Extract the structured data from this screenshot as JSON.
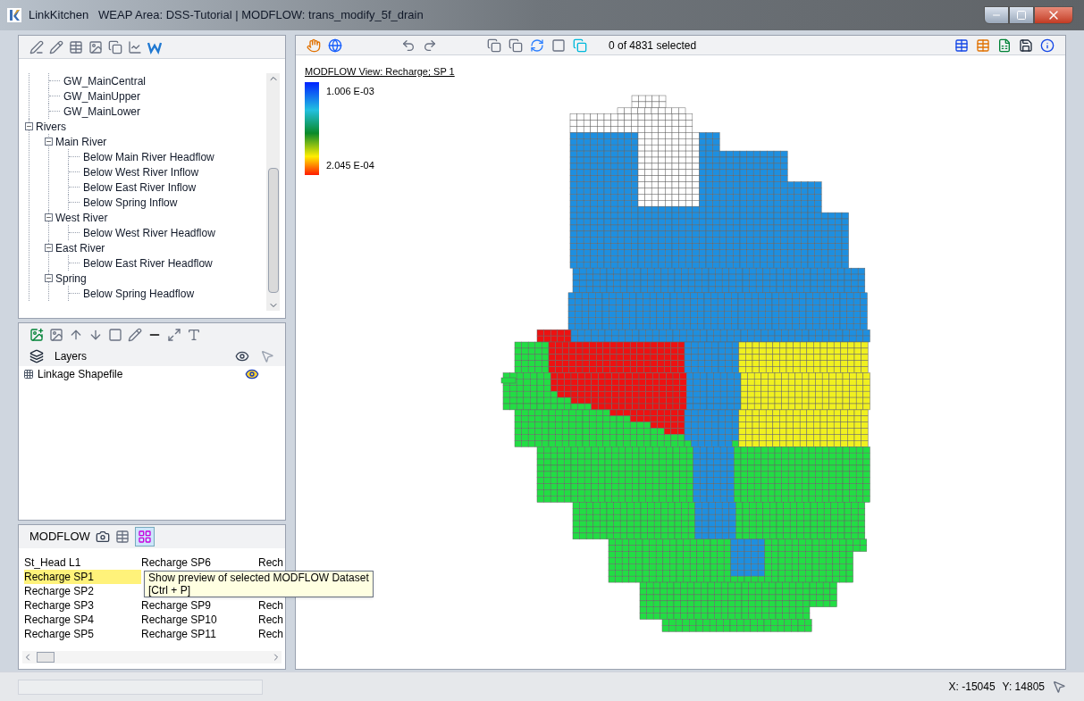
{
  "window": {
    "app_name": "LinkKitchen",
    "title": "WEAP Area: DSS-Tutorial | MODFLOW: trans_modify_5f_drain"
  },
  "tree": {
    "items": [
      {
        "children": [
          {
            "label": "GW_MainCentral"
          },
          {
            "label": "GW_MainUpper"
          },
          {
            "label": "GW_MainLower"
          }
        ]
      },
      {
        "label": "Rivers",
        "expanded": true,
        "children": [
          {
            "label": "Main River",
            "expanded": true,
            "children": [
              {
                "label": "Below Main River Headflow"
              },
              {
                "label": "Below West River Inflow"
              },
              {
                "label": "Below East River Inflow"
              },
              {
                "label": "Below Spring Inflow"
              }
            ]
          },
          {
            "label": "West River",
            "expanded": true,
            "children": [
              {
                "label": "Below West River Headflow"
              }
            ]
          },
          {
            "label": "East River",
            "expanded": true,
            "children": [
              {
                "label": "Below East River Headflow"
              }
            ]
          },
          {
            "label": "Spring",
            "expanded": true,
            "children": [
              {
                "label": "Below Spring Headflow"
              }
            ]
          }
        ]
      }
    ]
  },
  "layers": {
    "header": "Layers",
    "items": [
      {
        "label": "Linkage Shapefile",
        "visible": true
      }
    ]
  },
  "modflow": {
    "title": "MODFLOW",
    "columns": [
      [
        {
          "label": "St_Head L1",
          "selected": false
        },
        {
          "label": "Recharge SP1",
          "selected": true
        },
        {
          "label": "Recharge SP2",
          "selected": false
        },
        {
          "label": "Recharge SP3",
          "selected": false
        },
        {
          "label": "Recharge SP4",
          "selected": false
        },
        {
          "label": "Recharge SP5",
          "selected": false
        }
      ],
      [
        {
          "label": "Recharge SP6",
          "selected": false
        },
        null,
        null,
        {
          "label": "Recharge SP9",
          "selected": false
        },
        {
          "label": "Recharge SP10",
          "selected": false
        },
        {
          "label": "Recharge SP11",
          "selected": false
        }
      ],
      [
        {
          "label": "Rech",
          "selected": false
        },
        null,
        null,
        {
          "label": "Rech",
          "selected": false
        },
        {
          "label": "Rech",
          "selected": false
        },
        {
          "label": "Rech",
          "selected": false
        }
      ]
    ],
    "tooltip": [
      "Show preview of selected MODFLOW Dataset",
      "[Ctrl + P]"
    ]
  },
  "map_toolbar": {
    "selection_count": "0 of 4831 selected"
  },
  "map": {
    "title": "MODFLOW View: Recharge; SP 1",
    "legend": {
      "max": "1.006 E-03",
      "min": "2.045 E-04"
    }
  },
  "status_bar": {
    "x": "X: -15045",
    "y": "Y: 14805"
  }
}
